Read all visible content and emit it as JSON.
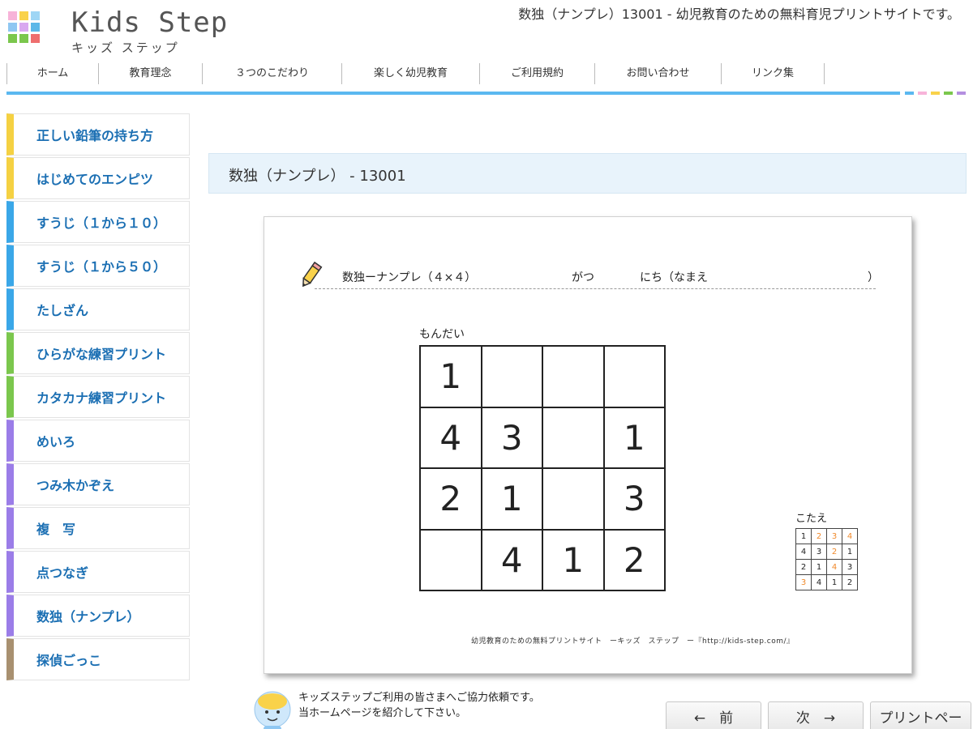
{
  "site": {
    "logo_title": "Kids Step",
    "logo_subtitle": "キッズ ステップ",
    "page_title": "数独（ナンプレ）13001 - 幼児教育のための無料育児プリントサイトです。",
    "logo_colors": [
      "#f7b3d9",
      "#f9d24a",
      "#8fc7f2",
      "#5cb8e8",
      "#7bc74d",
      "#ee6e6e"
    ]
  },
  "topnav": {
    "items": [
      "ホーム",
      "教育理念",
      "３つのこだわり",
      "楽しく幼児教育",
      "ご利用規約",
      "お問い合わせ",
      "リンク集"
    ]
  },
  "accent_colors": {
    "nav_line": "#5bb8f0",
    "dots": [
      "#5bb8f0",
      "#f7b3d9",
      "#f9d24a",
      "#7bc74d",
      "#b48fe0"
    ],
    "link": "#1b6fb3",
    "answer_highlight": "#f08a2c"
  },
  "sidebar": {
    "items": [
      {
        "label": "正しい鉛筆の持ち方",
        "color": "#f5d142"
      },
      {
        "label": "はじめてのエンピツ",
        "color": "#f5d142"
      },
      {
        "label": "すうじ（１から１０）",
        "color": "#3aa7e8"
      },
      {
        "label": "すうじ（１から５０）",
        "color": "#3aa7e8"
      },
      {
        "label": "たしざん",
        "color": "#3aa7e8"
      },
      {
        "label": "ひらがな練習プリント",
        "color": "#7bc74d"
      },
      {
        "label": "カタカナ練習プリント",
        "color": "#7bc74d"
      },
      {
        "label": "めいろ",
        "color": "#9b7de8"
      },
      {
        "label": "つみ木かぞえ",
        "color": "#9b7de8"
      },
      {
        "label": "複　写",
        "color": "#9b7de8"
      },
      {
        "label": "点つなぎ",
        "color": "#9b7de8"
      },
      {
        "label": "数独（ナンプレ）",
        "color": "#9b7de8"
      },
      {
        "label": "探偵ごっこ",
        "color": "#a89070"
      }
    ]
  },
  "main": {
    "heading": "数独（ナンプレ） - 13001"
  },
  "worksheet": {
    "title": "数独ーナンプレ（４×４）",
    "gatsu": "がつ",
    "nichi": "にち（なまえ",
    "close_paren": "）",
    "mondai_label": "もんだい",
    "puzzle": [
      [
        "1",
        "",
        "",
        ""
      ],
      [
        "4",
        "3",
        "",
        "1"
      ],
      [
        "2",
        "1",
        "",
        "3"
      ],
      [
        "",
        "4",
        "1",
        "2"
      ]
    ],
    "kotae_label": "こたえ",
    "answer": [
      [
        "1",
        "2",
        "3",
        "4"
      ],
      [
        "4",
        "3",
        "2",
        "1"
      ],
      [
        "2",
        "1",
        "4",
        "3"
      ],
      [
        "3",
        "4",
        "1",
        "2"
      ]
    ],
    "answer_filled": [
      [
        false,
        true,
        true,
        true
      ],
      [
        false,
        false,
        true,
        false
      ],
      [
        false,
        false,
        true,
        false
      ],
      [
        true,
        false,
        false,
        false
      ]
    ],
    "footer": "幼児教育のための無料プリントサイト　ーキッズ　ステップ　ー『http://kids-step.com/』"
  },
  "bottom": {
    "notice_lines": [
      "キッズステップご利用の皆さまへご協力依頼です。",
      "当ホームページを紹介して下さい。"
    ],
    "prev_label": "←　前",
    "next_label": "次　→",
    "print_label": "プリントペー"
  }
}
